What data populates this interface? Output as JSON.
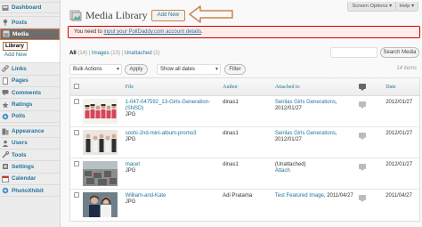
{
  "sidebar": {
    "items": [
      {
        "label": "Dashboard",
        "icon": "dashboard-icon",
        "color": "#7b7b7b"
      },
      {
        "label": "Posts",
        "icon": "pushpin-icon",
        "color": "#6a6a6a"
      },
      {
        "label": "Media",
        "icon": "media-icon",
        "color": "#ffffff"
      },
      {
        "label": "Links",
        "icon": "link-icon",
        "color": "#6a6a6a"
      },
      {
        "label": "Pages",
        "icon": "page-icon",
        "color": "#6a6a6a"
      },
      {
        "label": "Comments",
        "icon": "comment-icon",
        "color": "#6a6a6a"
      },
      {
        "label": "Ratings",
        "icon": "star-icon",
        "color": "#6a6a6a"
      },
      {
        "label": "Polls",
        "icon": "polls-icon",
        "color": "#6a6a6a"
      },
      {
        "label": "Appearance",
        "icon": "appearance-icon",
        "color": "#6a6a6a"
      },
      {
        "label": "Users",
        "icon": "users-icon",
        "color": "#6a6a6a"
      },
      {
        "label": "Tools",
        "icon": "tools-icon",
        "color": "#6a6a6a"
      },
      {
        "label": "Settings",
        "icon": "settings-icon",
        "color": "#6a6a6a"
      },
      {
        "label": "Calendar",
        "icon": "calendar-icon",
        "color": "#6a6a6a"
      },
      {
        "label": "PhotoXhibit",
        "icon": "photo-icon",
        "color": "#6a6a6a"
      }
    ],
    "media_submenu": [
      "Library",
      "Add New"
    ]
  },
  "header": {
    "title": "Media Library",
    "add_new": "Add New",
    "screen_options": "Screen Options ▾",
    "help": "Help ▾"
  },
  "notice": {
    "prefix": "You need to ",
    "link": "input your PollDaddy.com account details",
    "suffix": "."
  },
  "filters": {
    "all": "All",
    "all_count": "(14)",
    "images": "Images",
    "images_count": "(13)",
    "unattached": "Unattached",
    "unattached_count": "(2)",
    "search_button": "Search Media"
  },
  "controls": {
    "bulk": "Bulk Actions",
    "apply": "Apply",
    "dates": "Show all dates",
    "filter": "Filter",
    "items": "14 items"
  },
  "table": {
    "headers": {
      "file": "File",
      "author": "Author",
      "attached": "Attached to",
      "date": "Date"
    },
    "rows": [
      {
        "file": "1-047-047592_13-Girls-Generation-(SNSD)",
        "type": "JPG",
        "author": "dinas1",
        "attached": "Seirilas Girls Generations",
        "attached_date": ", 2012/01/27",
        "attach_link": "",
        "date": "2012/01/27",
        "thumb": "group-photo-1"
      },
      {
        "file": "soshi-2nd-mini-album-promo3",
        "type": "JPG",
        "author": "dinas1",
        "attached": "Seirilas Girls Generations",
        "attached_date": ", 2012/01/27",
        "attach_link": "",
        "date": "2012/01/27",
        "thumb": "group-photo-2"
      },
      {
        "file": "macet",
        "type": "JPG",
        "author": "dinas1",
        "attached": "(Unattached)",
        "attached_date": "",
        "attach_link": "Attach",
        "date": "2012/01/27",
        "thumb": "traffic-photo"
      },
      {
        "file": "William-and-Kate",
        "type": "JPG",
        "author": "Adi Pratama",
        "attached": "Test Featured Image",
        "attached_date": ", 2011/04/27",
        "attach_link": "",
        "date": "2011/04/27",
        "thumb": "couple-photo"
      }
    ]
  },
  "colors": {
    "link": "#21759b",
    "annotation": "#c9844d",
    "notice_border": "#cc0000",
    "notice_bg": "#ffebe8"
  }
}
